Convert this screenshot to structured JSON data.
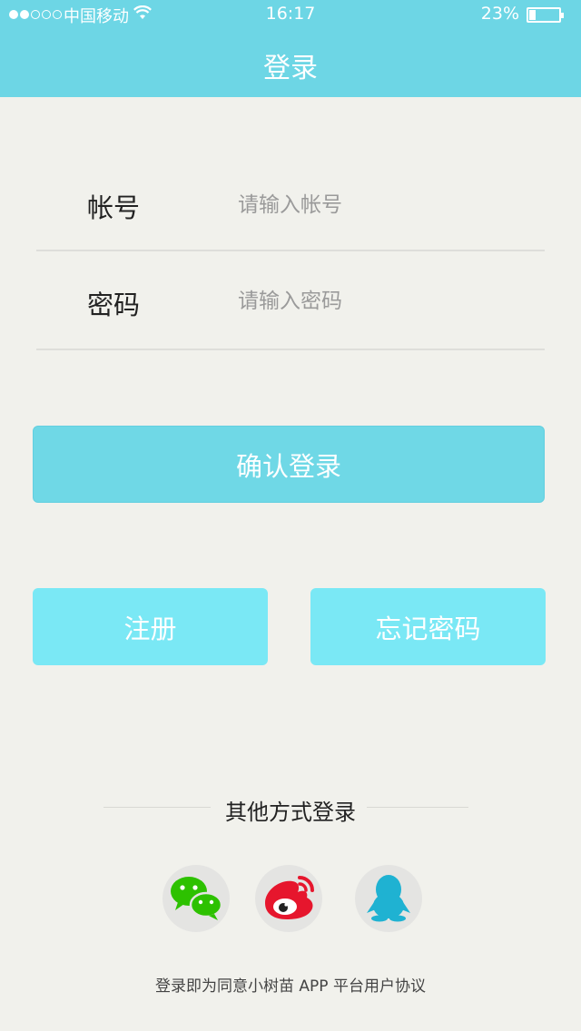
{
  "status_bar": {
    "carrier": "中国移动",
    "time": "16:17",
    "battery": "23%",
    "battery_level": 0.23,
    "signal_strength": 2
  },
  "header": {
    "title": "登录"
  },
  "form": {
    "account_label": "帐号",
    "account_placeholder": "请输入帐号",
    "password_label": "密码",
    "password_placeholder": "请输入密码"
  },
  "buttons": {
    "login": "确认登录",
    "register": "注册",
    "forgot": "忘记密码"
  },
  "other_login": {
    "title": "其他方式登录",
    "items": [
      {
        "icon": "wechat-icon",
        "color": "#2dc100"
      },
      {
        "icon": "weibo-icon",
        "color": "#e6162d"
      },
      {
        "icon": "qq-icon",
        "color": "#1fb2d2"
      }
    ]
  },
  "footer": {
    "agreement": "登录即为同意小树苗 APP 平台用户协议"
  },
  "colors": {
    "header_bg": "#6dd6e5",
    "login_button": "#6fd8e6",
    "secondary_button": "#7ae8f5",
    "background": "#f1f1ec"
  }
}
